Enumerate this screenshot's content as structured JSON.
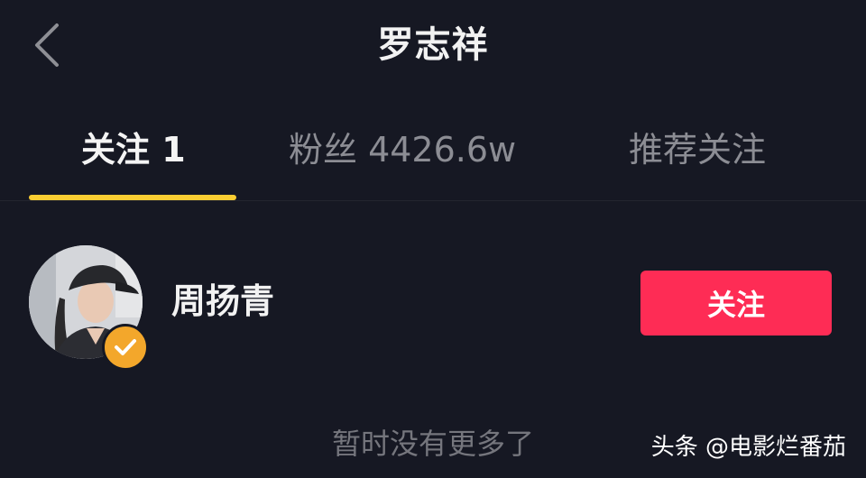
{
  "header": {
    "title": "罗志祥",
    "back_icon": "chevron-left-icon"
  },
  "tabs": [
    {
      "label": "关注 1",
      "active": true
    },
    {
      "label": "粉丝 4426.6w",
      "active": false
    },
    {
      "label": "推荐关注",
      "active": false
    }
  ],
  "list": [
    {
      "name": "周扬青",
      "verified": true,
      "button_label": "关注"
    }
  ],
  "empty_hint": "暂时没有更多了",
  "watermark": "头条 @电影烂番茄",
  "colors": {
    "background": "#161823",
    "accent": "#facd32",
    "follow_button": "#fe2c55",
    "verified_badge": "#f3a72b"
  }
}
